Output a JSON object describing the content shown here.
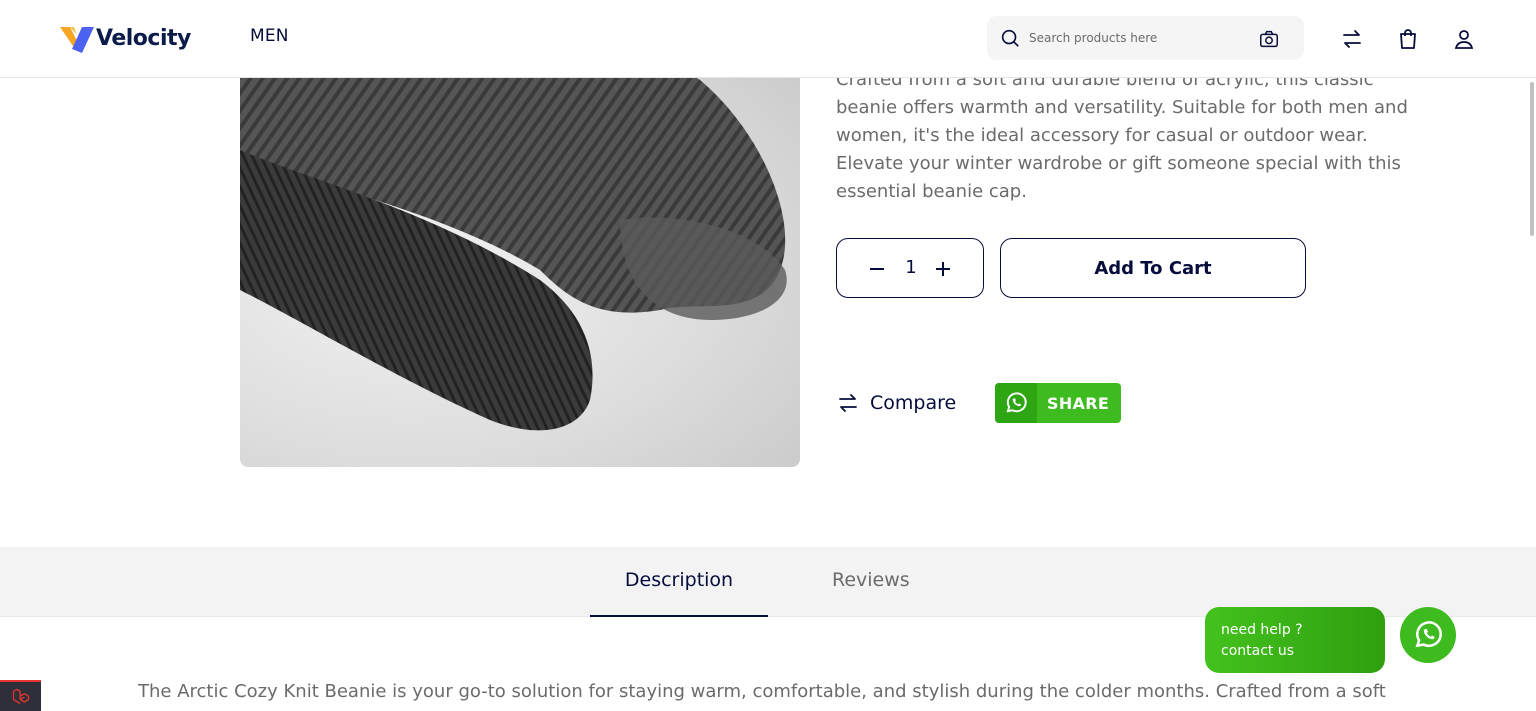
{
  "header": {
    "logo_text": "Velocity",
    "nav": [
      "MEN"
    ],
    "search_placeholder": "Search products here",
    "icons": [
      "search-icon",
      "camera-icon",
      "compare-icon",
      "cart-icon",
      "user-icon"
    ]
  },
  "product": {
    "image_icon": "beanie-image",
    "description": "Crafted from a soft and durable blend of acrylic, this classic beanie offers warmth and versatility. Suitable for both men and women, it's the ideal accessory for casual or outdoor wear. Elevate your winter wardrobe or gift someone special with this essential beanie cap.",
    "quantity": "1",
    "add_to_cart_label": "Add To Cart",
    "compare_label": "Compare",
    "share_label": "SHARE"
  },
  "tabs": {
    "items": [
      "Description",
      "Reviews"
    ],
    "active": "Description"
  },
  "long_description": "The Arctic Cozy Knit Beanie is your go-to solution for staying warm, comfortable, and stylish during the colder months. Crafted from a soft",
  "help": {
    "line1": "need help ?",
    "line2": "contact us"
  },
  "colors": {
    "brand_navy": "#060c3b",
    "whatsapp_green": "#3dbb1f",
    "muted_text": "#6b6b6b",
    "tab_bg": "#f3f3f3"
  }
}
